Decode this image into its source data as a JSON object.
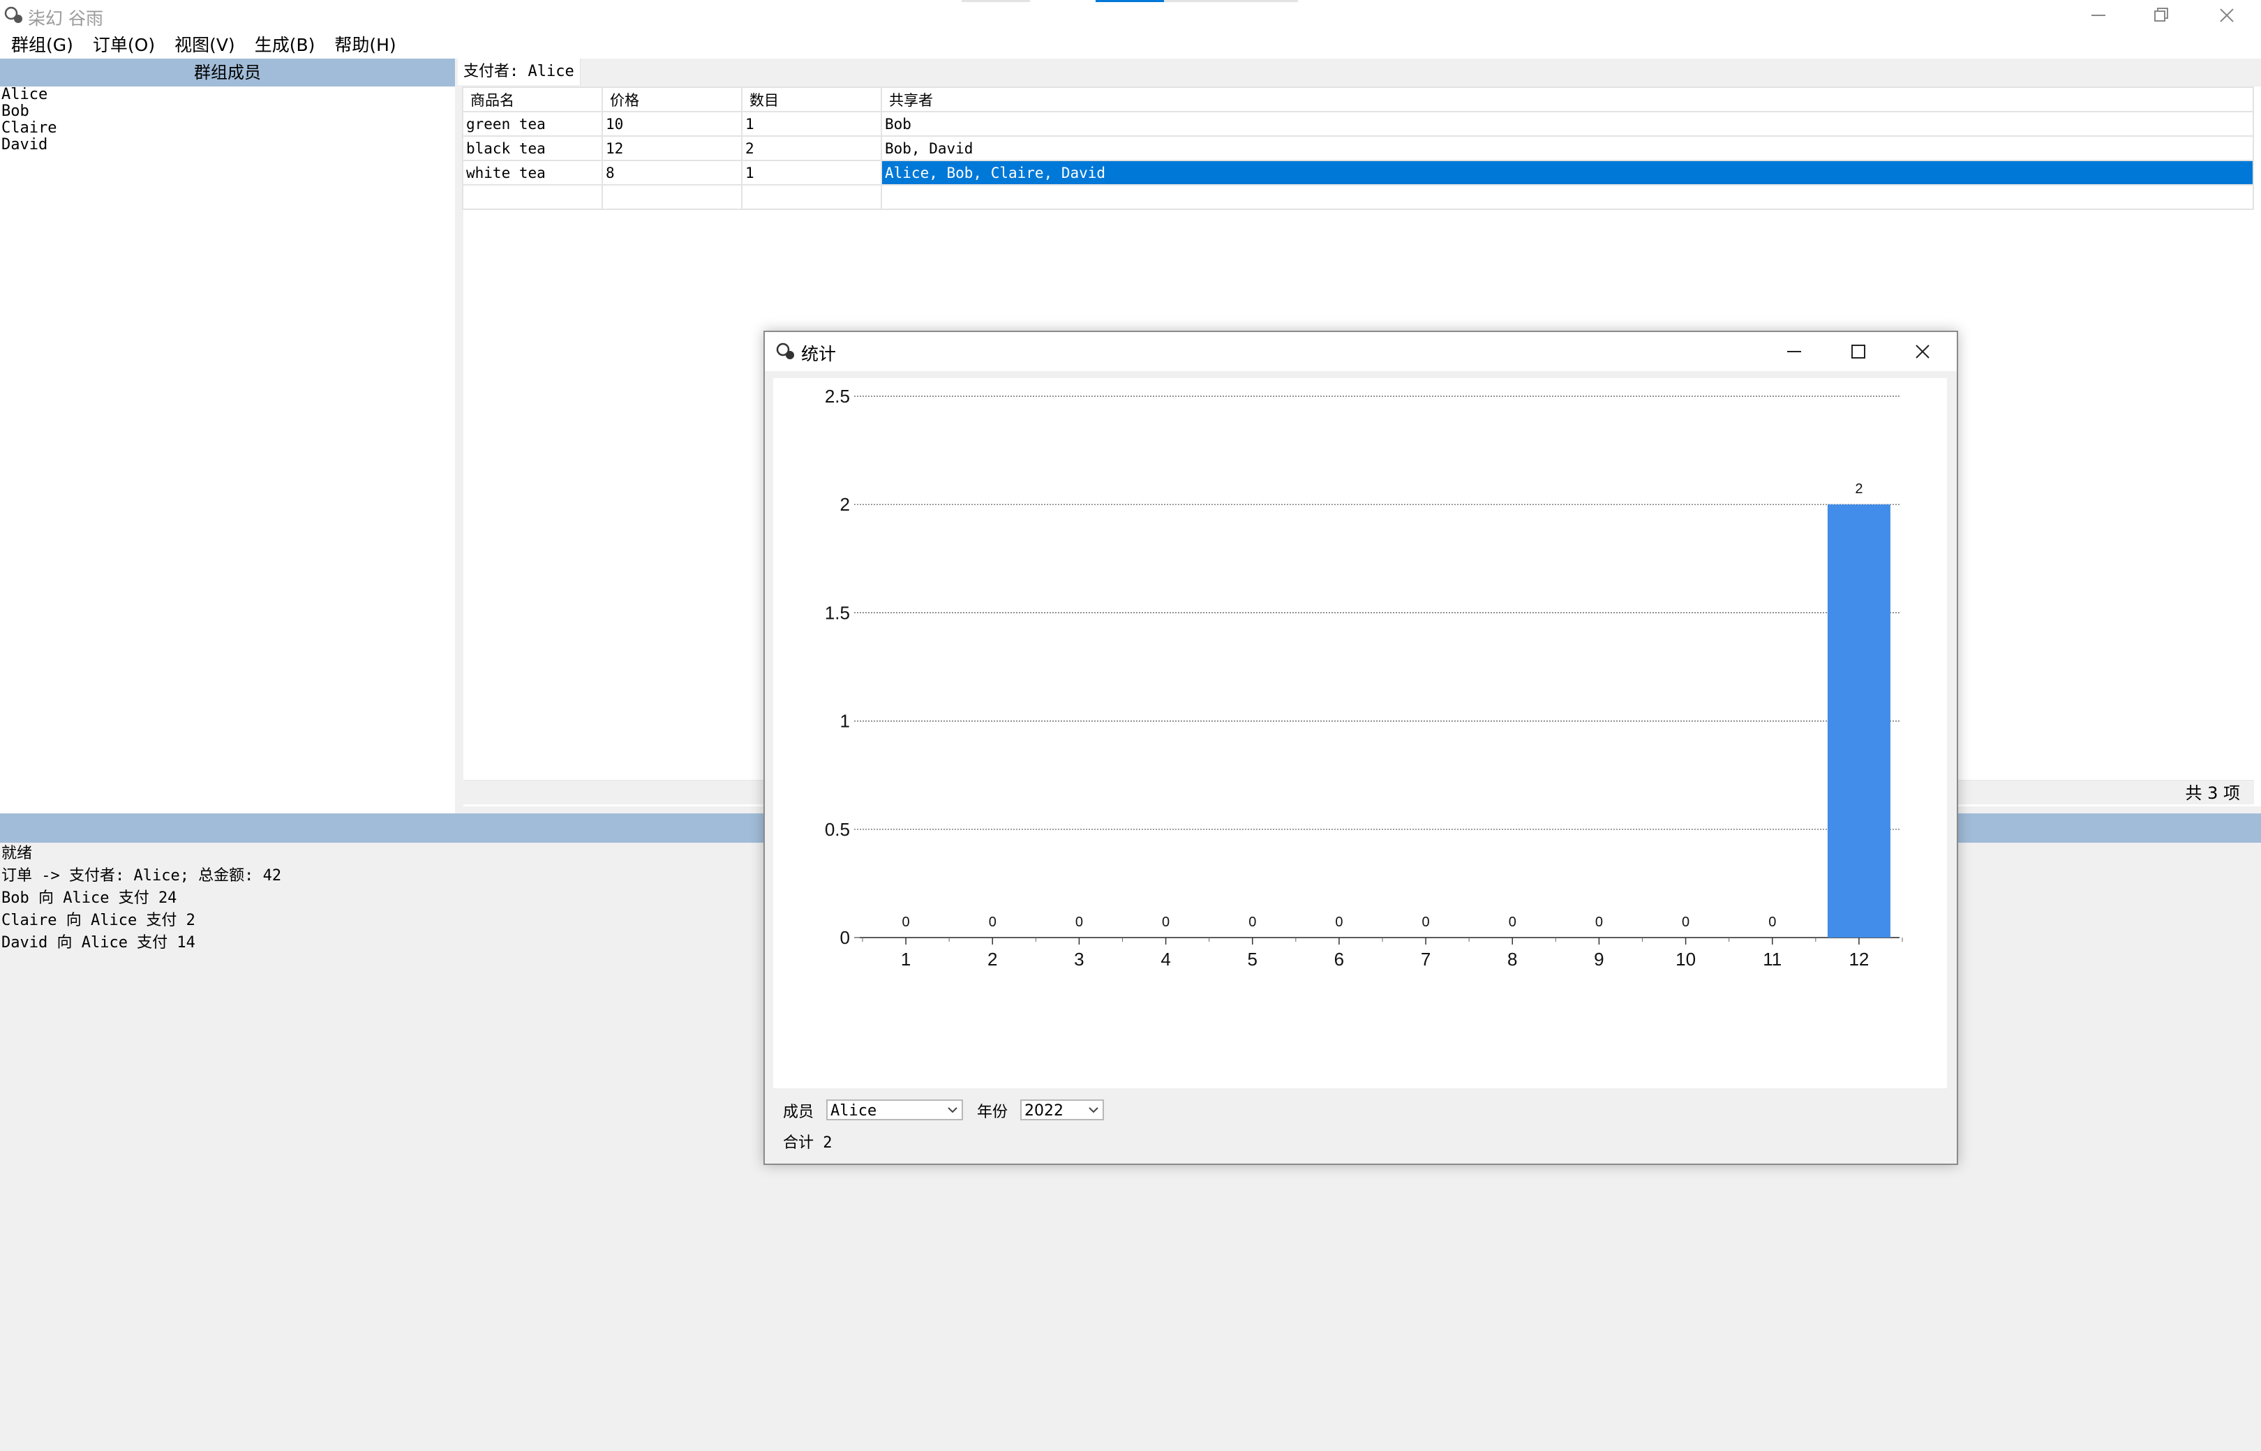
{
  "window": {
    "title": "柒幻 谷雨"
  },
  "menu": {
    "items": [
      "群组(G)",
      "订单(O)",
      "视图(V)",
      "生成(B)",
      "帮助(H)"
    ]
  },
  "members": {
    "header": "群组成员",
    "items": [
      "Alice",
      "Bob",
      "Claire",
      "David"
    ]
  },
  "order": {
    "payer_tab": "支付者: Alice",
    "columns": [
      "商品名",
      "价格",
      "数目",
      "共享者"
    ],
    "rows": [
      [
        "green tea",
        "10",
        "1",
        "Bob"
      ],
      [
        "black tea",
        "12",
        "2",
        "Bob, David"
      ],
      [
        "white tea",
        "8",
        "1",
        "Alice, Bob, Claire, David"
      ]
    ],
    "selected_row": 2,
    "total_items": "共 3 项"
  },
  "log": {
    "lines": [
      "就绪",
      "订单 -> 支付者: Alice; 总金额: 42",
      "Bob 向 Alice 支付 24",
      "Claire 向 Alice 支付 2",
      "David 向 Alice 支付 14"
    ]
  },
  "stats_dialog": {
    "title": "统计",
    "member_label": "成员",
    "member_value": "Alice",
    "year_label": "年份",
    "year_value": "2022",
    "total_text": "合计 2"
  },
  "chart_data": {
    "type": "bar",
    "categories": [
      "1",
      "2",
      "3",
      "4",
      "5",
      "6",
      "7",
      "8",
      "9",
      "10",
      "11",
      "12"
    ],
    "values": [
      0,
      0,
      0,
      0,
      0,
      0,
      0,
      0,
      0,
      0,
      0,
      2
    ],
    "yticks": [
      "0",
      "0.5",
      "1",
      "1.5",
      "2",
      "2.5"
    ],
    "ylim": [
      0,
      2.5
    ],
    "grid": true,
    "bar_color": "#418de9",
    "data_labels": true
  },
  "colors": {
    "accent": "#0078d7",
    "header_bg": "#a1bcd8"
  }
}
